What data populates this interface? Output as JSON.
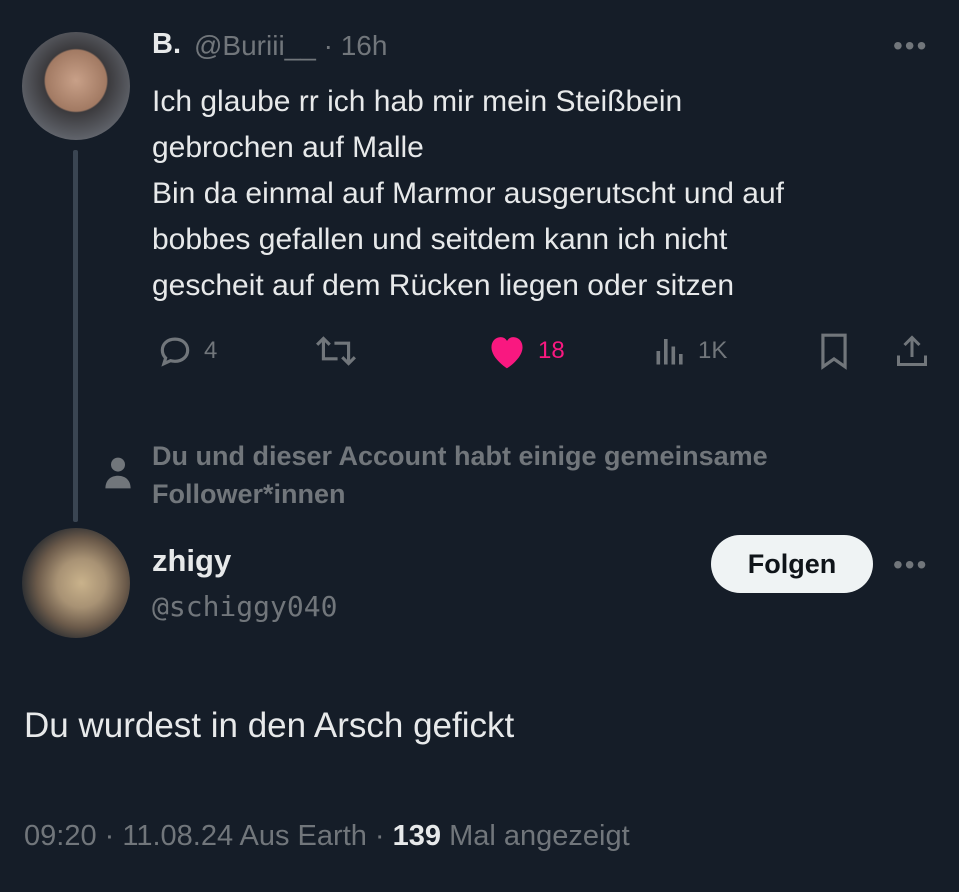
{
  "parent_tweet": {
    "display_name": "B.",
    "handle": "@Buriii__",
    "time": "· 16h",
    "text_lines": [
      "Ich glaube rr ich hab mir mein Steißbein",
      "gebrochen auf Malle",
      "Bin da einmal auf Marmor ausgerutscht und auf",
      "bobbes gefallen und seitdem kann ich nicht",
      "gescheit auf dem Rücken liegen oder sitzen"
    ],
    "replies": "4",
    "likes": "18",
    "views": "1K",
    "more": "•••"
  },
  "mutual_notice": {
    "line1": "Du und dieser Account habt einige gemeinsame",
    "line2": "Follower*innen"
  },
  "reply": {
    "display_name": "zhigy",
    "handle": "@schiggy040",
    "follow_label": "Folgen",
    "more": "•••",
    "text": "Du wurdest in den Arsch gefickt",
    "meta_prefix": "09:20 · 11.08.24 Aus Earth · ",
    "views_count": "139",
    "views_suffix": " Mal angezeigt"
  },
  "colors": {
    "background": "#151d28",
    "text": "#e7e9ea",
    "muted": "#71767b",
    "like": "#f91880"
  }
}
